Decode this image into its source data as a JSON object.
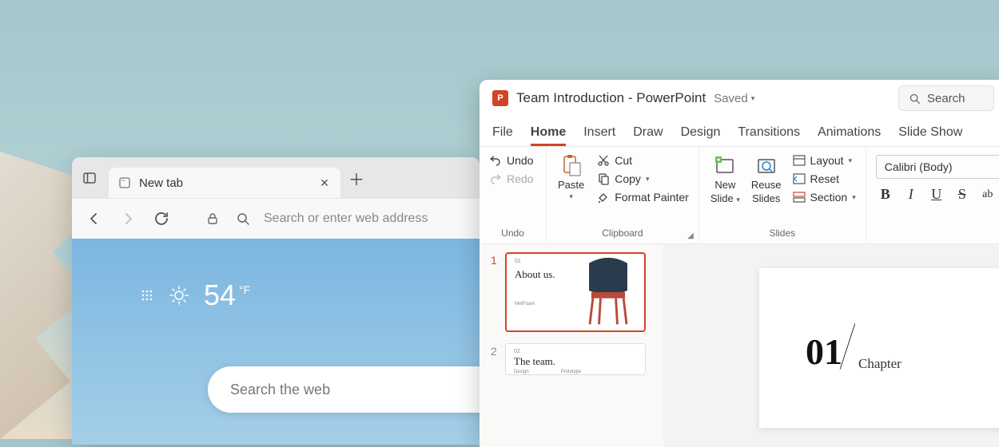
{
  "edge": {
    "tab_title": "New tab",
    "address_placeholder": "Search or enter web address",
    "weather_temp": "54",
    "weather_unit": "°F",
    "search_placeholder": "Search the web"
  },
  "pp": {
    "logo_letter": "P",
    "doc_title": "Team Introduction - PowerPoint",
    "save_status": "Saved",
    "search_label": "Search",
    "tabs": {
      "file": "File",
      "home": "Home",
      "insert": "Insert",
      "draw": "Draw",
      "design": "Design",
      "transitions": "Transitions",
      "animations": "Animations",
      "slideshow": "Slide Show"
    },
    "ribbon": {
      "undo_group": "Undo",
      "undo": "Undo",
      "redo": "Redo",
      "clipboard_group": "Clipboard",
      "paste": "Paste",
      "cut": "Cut",
      "copy": "Copy",
      "format_painter": "Format Painter",
      "slides_group": "Slides",
      "new_slide_l1": "New",
      "new_slide_l2": "Slide",
      "reuse_l1": "Reuse",
      "reuse_l2": "Slides",
      "layout": "Layout",
      "reset": "Reset",
      "section": "Section",
      "font_name": "Calibri (Body)",
      "bold": "B",
      "italic": "I",
      "underline": "U",
      "strike": "S",
      "ab": "ab"
    },
    "thumbs": {
      "n1": "1",
      "n2": "2",
      "t1_num": "01",
      "t1_title": "About us.",
      "t1_sub": "MetFoam",
      "t2_title": "The team.",
      "t2_colA": "Design",
      "t2_colB": "Prototype"
    },
    "slide": {
      "num": "01",
      "chapter": "Chapter"
    }
  }
}
